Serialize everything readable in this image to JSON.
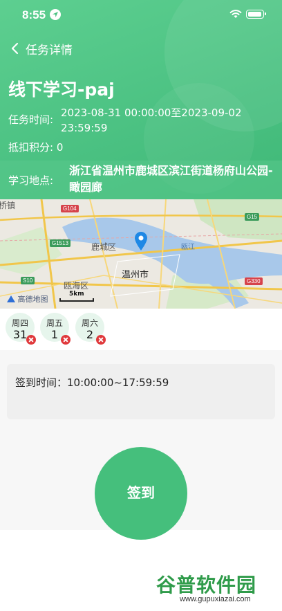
{
  "status_bar": {
    "time": "8:55"
  },
  "nav": {
    "back_label": "任务详情"
  },
  "task": {
    "title": "线下学习-paj",
    "time_label": "任务时间:",
    "time_value": "2023-08-31 00:00:00至2023-09-02 23:59:59",
    "points_text": "抵扣积分: 0",
    "location_label": "学习地点:",
    "location_value": "浙江省温州市鹿城区滨江街道杨府山公园-瞰园廊"
  },
  "map": {
    "labels": {
      "town_left": "桥镇",
      "lucheng": "鹿城区",
      "wenzhou": "温州市",
      "ouhai": "瓯海区",
      "river": "瓯江"
    },
    "shields": {
      "g104": "G104",
      "g15": "G15",
      "g1513": "G1513",
      "s10": "S10",
      "g330": "G330"
    },
    "logo": "高德地图",
    "scale": "5km"
  },
  "days": [
    {
      "name": "周四",
      "num": "31"
    },
    {
      "name": "周五",
      "num": "1"
    },
    {
      "name": "周六",
      "num": "2"
    }
  ],
  "checkin": {
    "text": "签到时间：10:00:00~17:59:59"
  },
  "sign_button": "签到",
  "watermark": {
    "top": "谷普软件园",
    "bottom": "www.gupuxiazai.com"
  },
  "colors": {
    "primary": "#45bf7c",
    "header": "#4cc283",
    "error": "#e0393c"
  }
}
